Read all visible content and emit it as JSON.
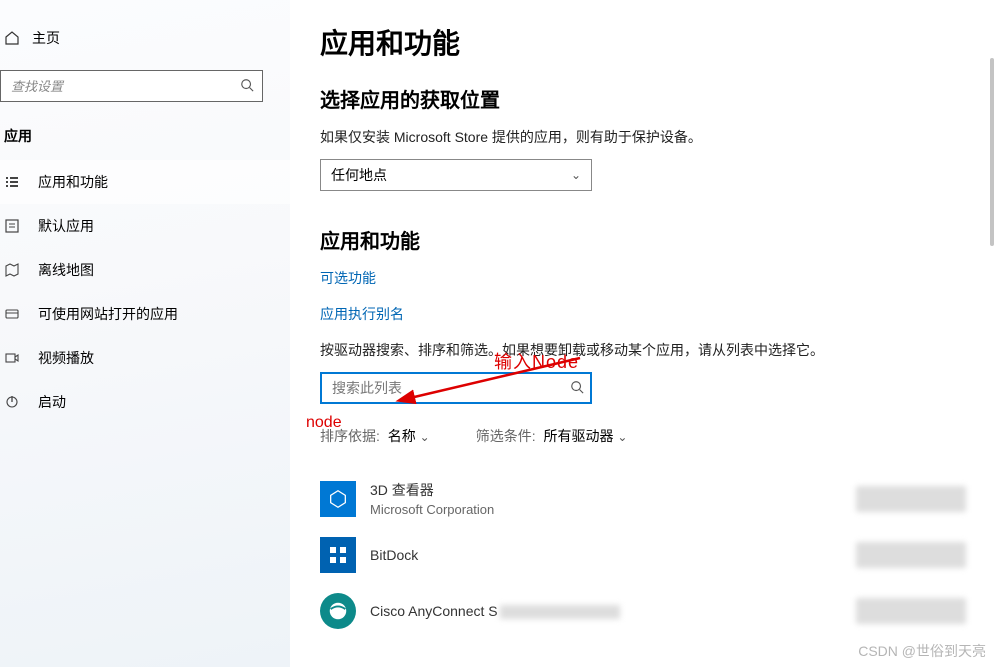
{
  "sidebar": {
    "home": "主页",
    "search_placeholder": "查找设置",
    "category": "应用",
    "items": [
      {
        "label": "应用和功能"
      },
      {
        "label": "默认应用"
      },
      {
        "label": "离线地图"
      },
      {
        "label": "可使用网站打开的应用"
      },
      {
        "label": "视频播放"
      },
      {
        "label": "启动"
      }
    ]
  },
  "main": {
    "title": "应用和功能",
    "section_where": {
      "heading": "选择应用的获取位置",
      "desc": "如果仅安装 Microsoft Store 提供的应用，则有助于保护设备。",
      "dropdown_value": "任何地点"
    },
    "section_apps": {
      "heading": "应用和功能",
      "link_optional": "可选功能",
      "link_alias": "应用执行别名",
      "desc": "按驱动器搜索、排序和筛选。如果想要卸载或移动某个应用，请从列表中选择它。",
      "search_placeholder": "搜索此列表",
      "sort_label": "排序依据:",
      "sort_value": "名称",
      "filter_label": "筛选条件:",
      "filter_value": "所有驱动器"
    },
    "apps": [
      {
        "name": "3D 查看器",
        "publisher": "Microsoft Corporation"
      },
      {
        "name": "BitDock",
        "publisher": ""
      },
      {
        "name": "Cisco AnyConnect S",
        "publisher": ""
      }
    ]
  },
  "annotations": {
    "input_node": "输入Node",
    "node": "node"
  },
  "watermark": "CSDN @世俗到天亮"
}
